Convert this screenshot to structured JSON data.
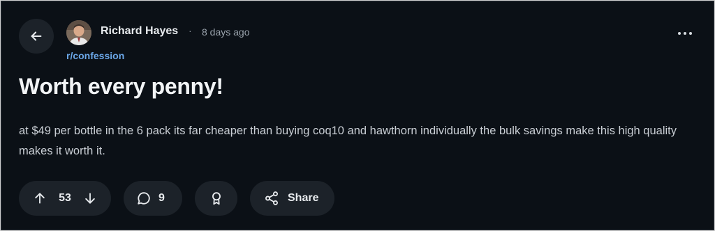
{
  "post": {
    "author": "Richard Hayes",
    "separator": "·",
    "time_ago": "8 days ago",
    "subreddit": "r/confession",
    "title": "Worth every penny!",
    "body": "at $49 per bottle in the 6 pack its far cheaper than buying coq10 and hawthorn individually the bulk savings make this high quality makes it worth it."
  },
  "actions": {
    "vote_count": "53",
    "comment_count": "9",
    "share_label": "Share"
  },
  "icons": {
    "back": "arrow-left-icon",
    "more": "more-horizontal-icon",
    "upvote": "arrow-up-icon",
    "downvote": "arrow-down-icon",
    "comment": "comment-bubble-icon",
    "award": "award-ribbon-icon",
    "share": "share-nodes-icon"
  },
  "colors": {
    "background": "#0b1016",
    "pill": "#1c2229",
    "subreddit_link": "#6ba7e8",
    "text": "#c9ced4"
  }
}
